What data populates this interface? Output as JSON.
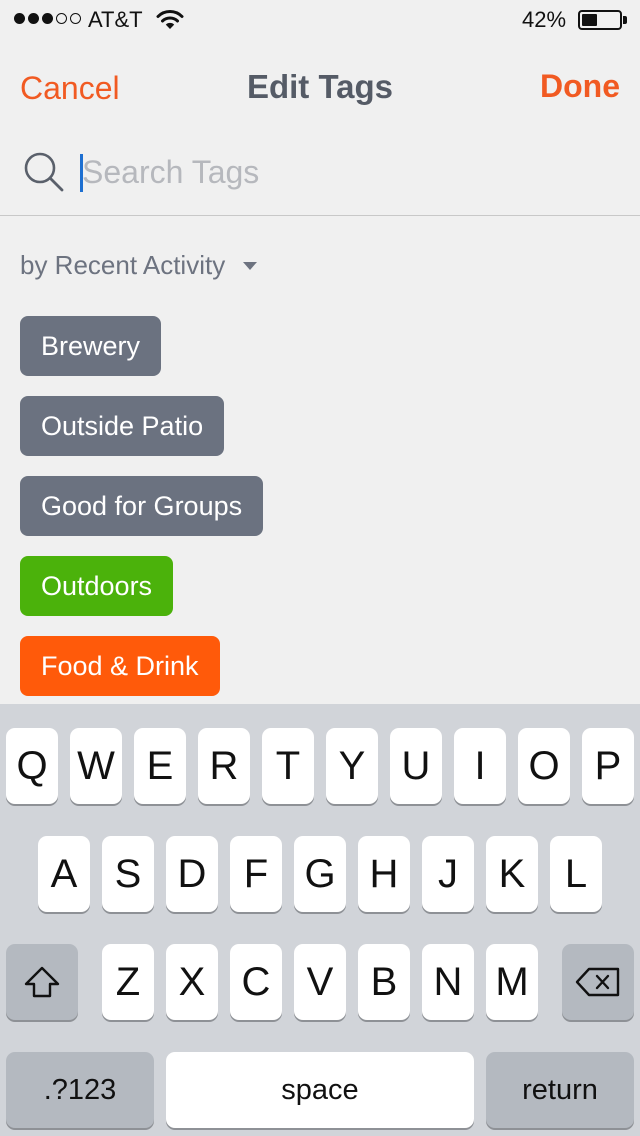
{
  "status_bar": {
    "signal": {
      "filled": 3,
      "total": 5
    },
    "carrier": "AT&T",
    "wifi_icon": "wifi-icon",
    "battery_percent": "42%",
    "battery_level": 0.42
  },
  "nav": {
    "cancel_label": "Cancel",
    "title": "Edit Tags",
    "done_label": "Done"
  },
  "search": {
    "placeholder": "Search Tags",
    "value": "",
    "icon": "search-icon"
  },
  "sort": {
    "label": "by Recent Activity",
    "icon": "dropdown-arrow-icon"
  },
  "tags": [
    {
      "label": "Brewery",
      "color": "#6b7280"
    },
    {
      "label": "Outside Patio",
      "color": "#6b7280"
    },
    {
      "label": "Good for Groups",
      "color": "#6b7280"
    },
    {
      "label": "Outdoors",
      "color": "#4bb20b"
    },
    {
      "label": "Food & Drink",
      "color": "#ff5a0a"
    }
  ],
  "keyboard": {
    "rows": [
      [
        "Q",
        "W",
        "E",
        "R",
        "T",
        "Y",
        "U",
        "I",
        "O",
        "P"
      ],
      [
        "A",
        "S",
        "D",
        "F",
        "G",
        "H",
        "J",
        "K",
        "L"
      ],
      [
        "Z",
        "X",
        "C",
        "V",
        "B",
        "N",
        "M"
      ]
    ],
    "shift_icon": "shift-icon",
    "backspace_icon": "backspace-icon",
    "numbers_label": ".?123",
    "space_label": "space",
    "return_label": "return"
  },
  "colors": {
    "accent": "#f15a22",
    "title": "#555b66",
    "background": "#f0f0f0",
    "keyboard_bg": "#d1d4d9",
    "function_key": "#b4b9c0"
  }
}
